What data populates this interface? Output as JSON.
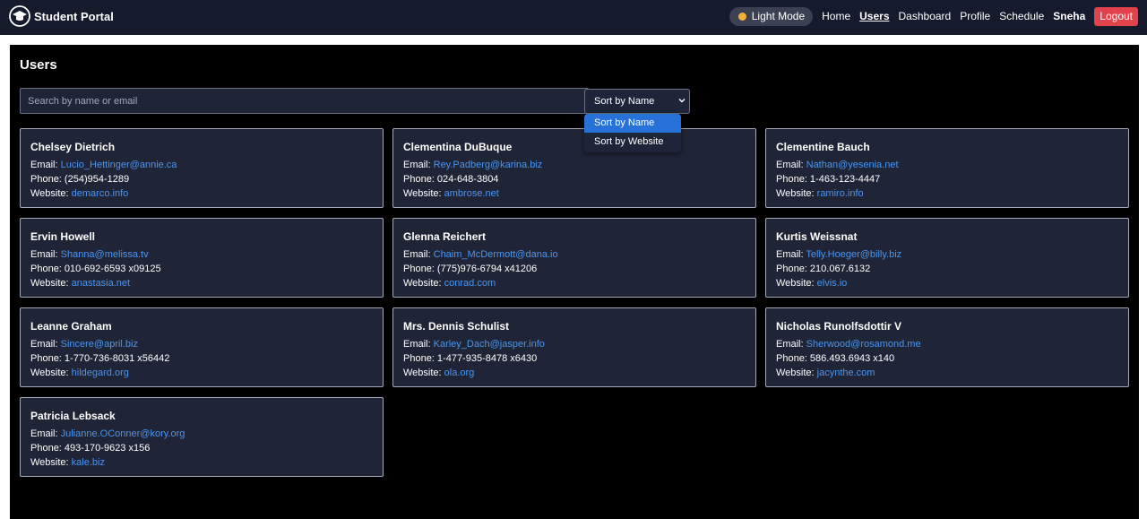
{
  "navbar": {
    "brand": "Student Portal",
    "mode_toggle": "Light Mode",
    "links": [
      "Home",
      "Users",
      "Dashboard",
      "Profile",
      "Schedule"
    ],
    "active_link": "Users",
    "user": "Sneha",
    "logout": "Logout",
    "colors": {
      "bg": "#151a2d",
      "logout": "#e1424b",
      "toggle_dot": "#f4b13a"
    }
  },
  "page": {
    "title": "Users",
    "search_placeholder": "Search by name or email",
    "sort": {
      "selected": "Sort by Name",
      "options": [
        "Sort by Name",
        "Sort by Website"
      ]
    }
  },
  "labels": {
    "email": "Email: ",
    "phone": "Phone: ",
    "website": "Website: "
  },
  "users": [
    {
      "name": "Chelsey Dietrich",
      "email": "Lucio_Hettinger@annie.ca",
      "phone": "(254)954-1289",
      "website": "demarco.info"
    },
    {
      "name": "Clementina DuBuque",
      "email": "Rey.Padberg@karina.biz",
      "phone": "024-648-3804",
      "website": "ambrose.net"
    },
    {
      "name": "Clementine Bauch",
      "email": "Nathan@yesenia.net",
      "phone": "1-463-123-4447",
      "website": "ramiro.info"
    },
    {
      "name": "Ervin Howell",
      "email": "Shanna@melissa.tv",
      "phone": "010-692-6593 x09125",
      "website": "anastasia.net"
    },
    {
      "name": "Glenna Reichert",
      "email": "Chaim_McDermott@dana.io",
      "phone": "(775)976-6794 x41206",
      "website": "conrad.com"
    },
    {
      "name": "Kurtis Weissnat",
      "email": "Telly.Hoeger@billy.biz",
      "phone": "210.067.6132",
      "website": "elvis.io"
    },
    {
      "name": "Leanne Graham",
      "email": "Sincere@april.biz",
      "phone": "1-770-736-8031 x56442",
      "website": "hildegard.org"
    },
    {
      "name": "Mrs. Dennis Schulist",
      "email": "Karley_Dach@jasper.info",
      "phone": "1-477-935-8478 x6430",
      "website": "ola.org"
    },
    {
      "name": "Nicholas Runolfsdottir V",
      "email": "Sherwood@rosamond.me",
      "phone": "586.493.6943 x140",
      "website": "jacynthe.com"
    },
    {
      "name": "Patricia Lebsack",
      "email": "Julianne.OConner@kory.org",
      "phone": "493-170-9623 x156",
      "website": "kale.biz"
    }
  ],
  "icons": {
    "brand": "graduation-cap-icon",
    "sort": "chevron-down-icon",
    "mode": "sun-icon"
  },
  "colors": {
    "card_bg": "#1f2536",
    "link": "#4b95f0",
    "selected_option": "#2772d9"
  }
}
